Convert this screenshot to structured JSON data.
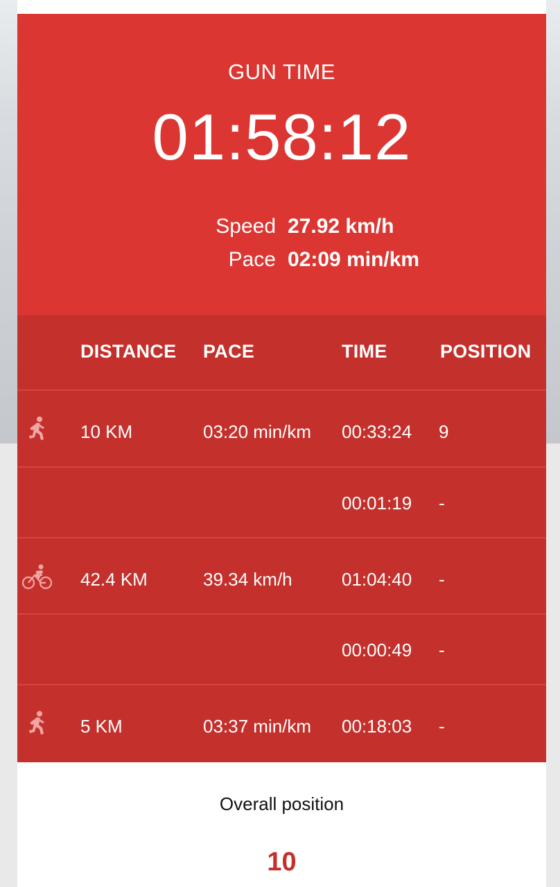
{
  "hero": {
    "label": "GUN TIME",
    "time": "01:58:12",
    "speed_label": "Speed",
    "speed_value": "27.92 km/h",
    "pace_label": "Pace",
    "pace_value": "02:09 min/km"
  },
  "table": {
    "headers": {
      "distance": "DISTANCE",
      "pace": "PACE",
      "time": "TIME",
      "position": "POSITION"
    },
    "rows": [
      {
        "icon": "runner-icon",
        "distance": "10 KM",
        "pace": "03:20 min/km",
        "time": "00:33:24",
        "position": "9"
      },
      {
        "icon": "",
        "distance": "",
        "pace": "",
        "time": "00:01:19",
        "position": "-"
      },
      {
        "icon": "cyclist-icon",
        "distance": "42.4 KM",
        "pace": "39.34 km/h",
        "time": "01:04:40",
        "position": "-"
      },
      {
        "icon": "",
        "distance": "",
        "pace": "",
        "time": "00:00:49",
        "position": "-"
      },
      {
        "icon": "runner-icon",
        "distance": "5 KM",
        "pace": "03:37 min/km",
        "time": "00:18:03",
        "position": "-"
      }
    ]
  },
  "overall": {
    "label": "Overall position",
    "value": "10"
  },
  "colors": {
    "hero_red": "#db3632",
    "table_red": "#c4302c",
    "row_divider": "#d94440",
    "icon_pink": "#f2a7a4"
  }
}
